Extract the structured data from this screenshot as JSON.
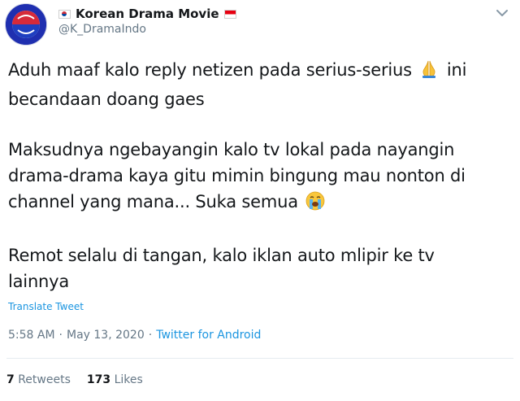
{
  "header": {
    "display_name": "Korean Drama Movie",
    "handle": "@K_DramaIndo",
    "icons": [
      "flag-south-korea-icon",
      "flag-indonesia-icon",
      "chevron-down-icon"
    ]
  },
  "body": {
    "p1": "Aduh maaf kalo reply netizen pada serius-serius",
    "p1_tail": "ini becandaan doang gaes",
    "p2": "Maksudnya ngebayangin kalo tv lokal pada nayangin drama-drama kaya gitu mimin bingung mau nonton di channel yang mana... Suka semua",
    "p3": "Remot selalu di tangan, kalo iklan auto mlipir ke tv lainnya",
    "emojis": [
      "folded-hands-icon",
      "loudly-crying-face-icon"
    ]
  },
  "translate_label": "Translate Tweet",
  "meta": {
    "time": "5:58 AM",
    "separator": "·",
    "date": "May 13, 2020",
    "separator2": "·",
    "source": "Twitter for Android"
  },
  "stats": {
    "retweets_count": "7",
    "retweets_label": "Retweets",
    "likes_count": "173",
    "likes_label": "Likes"
  },
  "colors": {
    "link": "#1b95e0",
    "secondary_text": "#657786",
    "primary_text": "#14171a",
    "divider": "#e6ecf0"
  }
}
